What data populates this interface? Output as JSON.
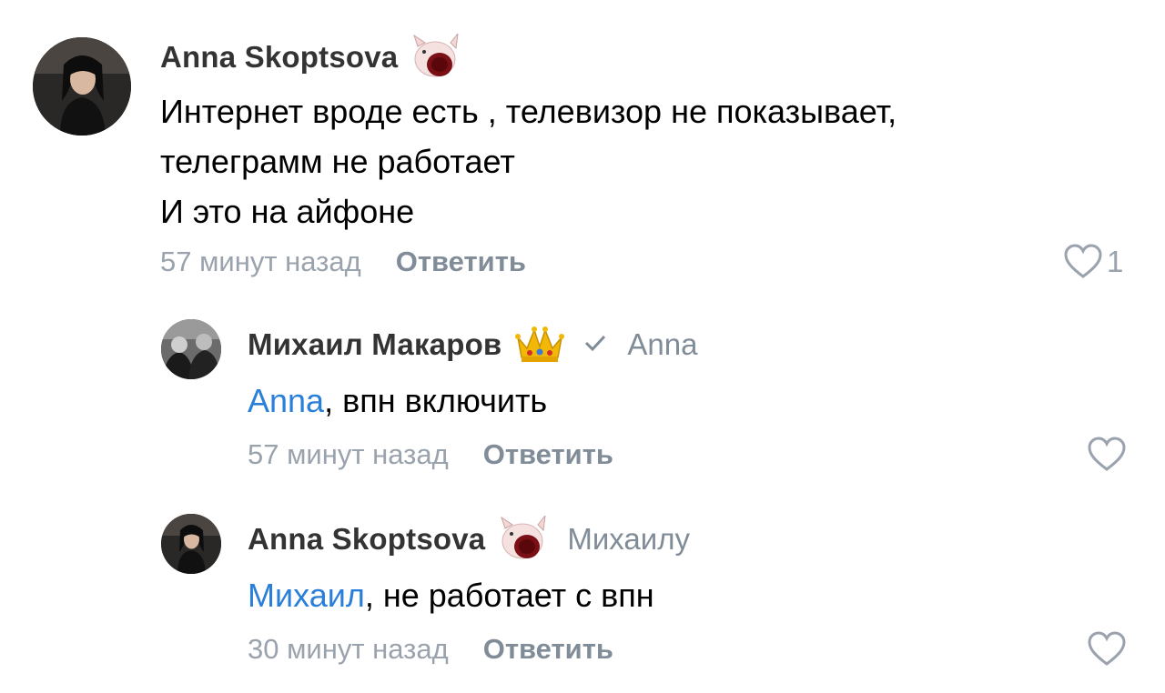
{
  "colors": {
    "author": "#333333",
    "secondary": "#818c99",
    "timestamp": "#9aa3ad",
    "mention": "#2a7fd8",
    "text": "#000000"
  },
  "comments": [
    {
      "author": "Anna Skoptsova",
      "sticker_icon": "cat-sticker-icon",
      "lines": [
        "Интернет вроде есть , телевизор не показывает,",
        "телеграмм не работает",
        "И это на айфоне"
      ],
      "time": "57 минут назад",
      "reply_label": "Ответить",
      "likes": "1"
    },
    {
      "author": "Михаил Макаров",
      "sticker_icon": "crown-icon",
      "verified_icon": "checkmark-icon",
      "reply_to": "Anna",
      "mention": "Anna",
      "text_rest": ", впн включить",
      "time": "57 минут назад",
      "reply_label": "Ответить"
    },
    {
      "author": "Anna Skoptsova",
      "sticker_icon": "cat-sticker-icon",
      "reply_to": "Михаилу",
      "mention": "Михаил",
      "text_rest": ", не работает с впн",
      "time": "30 минут назад",
      "reply_label": "Ответить"
    }
  ]
}
